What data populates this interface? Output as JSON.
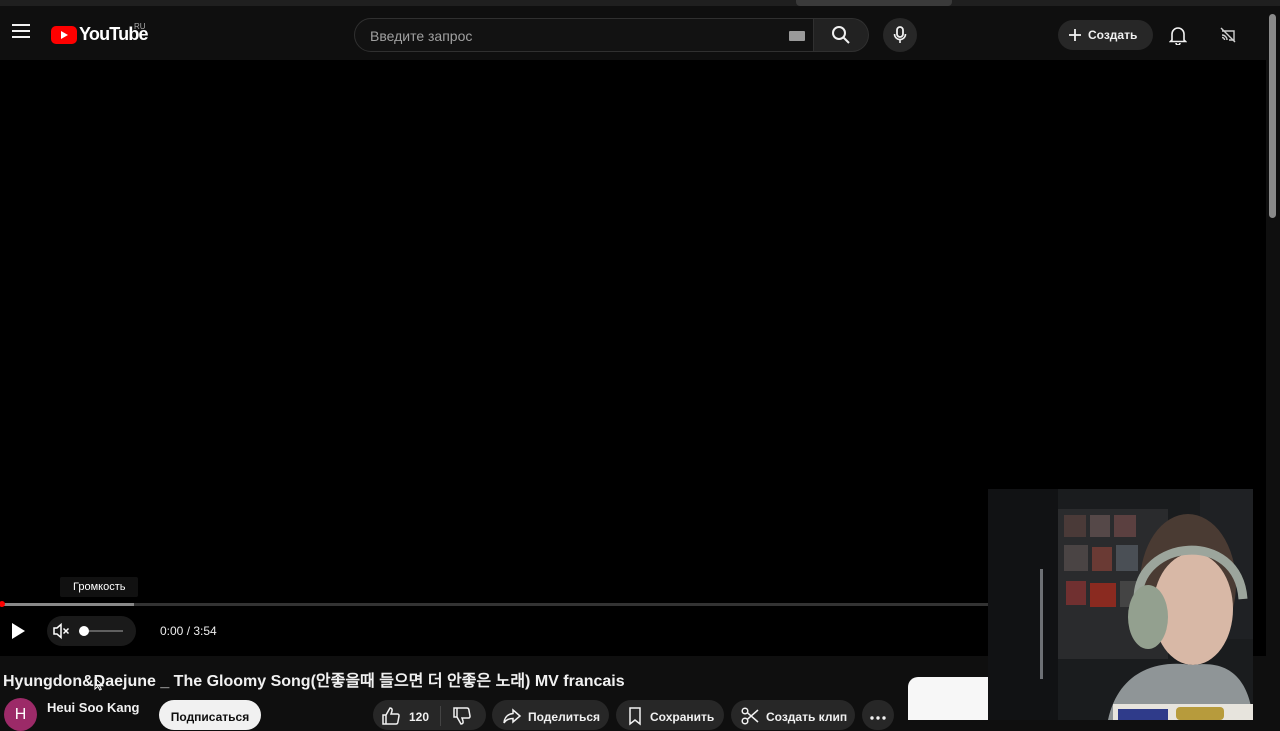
{
  "masthead": {
    "logo_text": "YouTube",
    "logo_region": "RU",
    "search_placeholder": "Введите запрос",
    "create_label": "Создать"
  },
  "player": {
    "tooltip": "Громкость",
    "time_display": "0:00 / 3:54",
    "progress_fraction": 0,
    "loaded_fraction": 0.134,
    "muted": true,
    "volume_fraction": 0
  },
  "video": {
    "title": "Hyungdon&Daejune _ The Gloomy Song(안좋을때 들으면 더 안좋은 노래) MV francais"
  },
  "owner": {
    "avatar_letter": "H",
    "channel_name": "Heui Soo Kang",
    "subscribe_label": "Подписаться"
  },
  "actions": {
    "like_count": "120",
    "share_label": "Поделиться",
    "save_label": "Сохранить",
    "clip_label": "Создать клип"
  },
  "colors": {
    "background": "#0f0f0f",
    "brand_red": "#ff0000",
    "avatar": "#9c2a68"
  }
}
